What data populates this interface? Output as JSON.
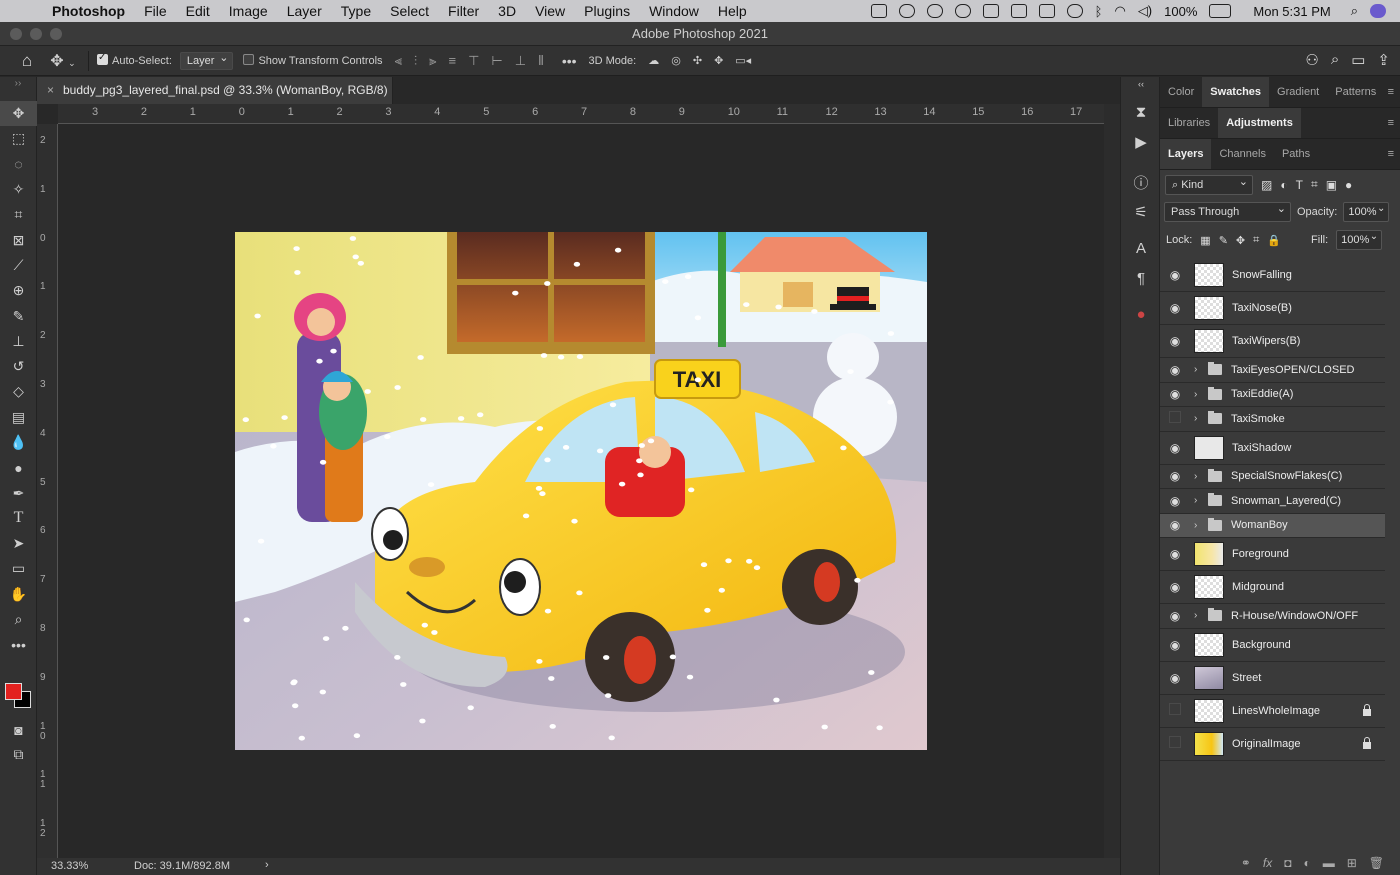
{
  "menubar": {
    "app": "Photoshop",
    "items": [
      "File",
      "Edit",
      "Image",
      "Layer",
      "Type",
      "Select",
      "Filter",
      "3D",
      "View",
      "Plugins",
      "Window",
      "Help"
    ],
    "battery": "100%",
    "clock": "Mon 5:31 PM"
  },
  "window": {
    "title": "Adobe Photoshop 2021"
  },
  "options": {
    "auto_select_label": "Auto-Select:",
    "auto_select_target": "Layer",
    "show_transform_label": "Show Transform Controls",
    "mode_3d_label": "3D Mode:"
  },
  "document": {
    "tab_title": "buddy_pg3_layered_final.psd @ 33.3% (WomanBoy, RGB/8)",
    "zoom": "33.33%",
    "doc_size": "Doc: 39.1M/892.8M"
  },
  "rulers": {
    "h": [
      "3",
      "2",
      "1",
      "0",
      "1",
      "2",
      "3",
      "4",
      "5",
      "6",
      "7",
      "8",
      "9",
      "10",
      "11",
      "12",
      "13",
      "14",
      "15",
      "16",
      "17"
    ],
    "v": [
      "2",
      "1",
      "0",
      "1",
      "2",
      "3",
      "4",
      "5",
      "6",
      "7",
      "8",
      "9",
      "1\n0",
      "1\n1",
      "1\n2"
    ]
  },
  "panels": {
    "top_tabs": [
      "Color",
      "Swatches",
      "Gradient",
      "Patterns"
    ],
    "mid_tabs": [
      "Libraries",
      "Adjustments"
    ],
    "layer_tabs": [
      "Layers",
      "Channels",
      "Paths"
    ]
  },
  "layers_panel": {
    "kind_label": "Kind",
    "blend_mode": "Pass Through",
    "opacity_label": "Opacity:",
    "opacity": "100%",
    "lock_label": "Lock:",
    "fill_label": "Fill:",
    "fill": "100%"
  },
  "layers": [
    {
      "name": "SnowFalling",
      "visible": true,
      "group": false,
      "thumb": "trans"
    },
    {
      "name": "TaxiNose(B)",
      "visible": true,
      "group": false,
      "thumb": "trans"
    },
    {
      "name": "TaxiWipers(B)",
      "visible": true,
      "group": false,
      "thumb": "trans"
    },
    {
      "name": "TaxiEyesOPEN/CLOSED",
      "visible": true,
      "group": true
    },
    {
      "name": "TaxiEddie(A)",
      "visible": true,
      "group": true
    },
    {
      "name": "TaxiSmoke",
      "visible": false,
      "group": true
    },
    {
      "name": "TaxiShadow",
      "visible": true,
      "group": false,
      "thumb": "shadow"
    },
    {
      "name": "SpecialSnowFlakes(C)",
      "visible": true,
      "group": true
    },
    {
      "name": "Snowman_Layered(C)",
      "visible": true,
      "group": true
    },
    {
      "name": "WomanBoy",
      "visible": true,
      "group": true,
      "selected": true
    },
    {
      "name": "Foreground",
      "visible": true,
      "group": false,
      "thumb": "fg"
    },
    {
      "name": "Midground",
      "visible": true,
      "group": false,
      "thumb": "trans"
    },
    {
      "name": "R-House/WindowON/OFF",
      "visible": true,
      "group": true
    },
    {
      "name": "Background",
      "visible": true,
      "group": false,
      "thumb": "trans"
    },
    {
      "name": "Street",
      "visible": true,
      "group": false,
      "thumb": "street"
    },
    {
      "name": "LinesWholeImage",
      "visible": false,
      "group": false,
      "thumb": "trans",
      "locked": true
    },
    {
      "name": "OriginalImage",
      "visible": false,
      "group": false,
      "thumb": "orig",
      "locked": true
    }
  ],
  "artwork": {
    "taxi_sign": "TAXI"
  },
  "colors": {
    "foreground": "#e3211f",
    "background": "#000000",
    "taxi": "#f7c514",
    "wall": "#eee27a",
    "sky": "#8fd4f5"
  }
}
